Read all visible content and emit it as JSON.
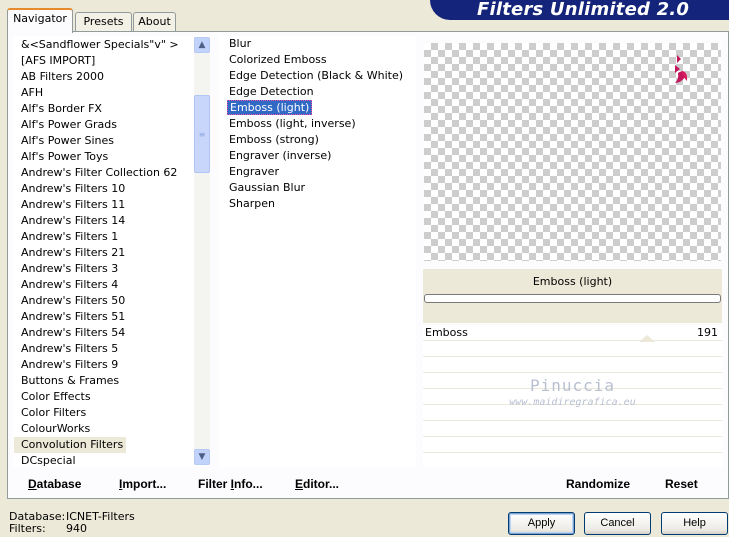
{
  "tabs": [
    {
      "label": "Navigator",
      "active": true
    },
    {
      "label": "Presets",
      "active": false
    },
    {
      "label": "About",
      "active": false
    }
  ],
  "app_title": "Filters Unlimited 2.0",
  "categories": [
    "&<Sandflower Specials\"v\" >",
    "[AFS IMPORT]",
    "AB Filters 2000",
    "AFH",
    "Alf's Border FX",
    "Alf's Power Grads",
    "Alf's Power Sines",
    "Alf's Power Toys",
    "Andrew's Filter Collection 62",
    "Andrew's Filters 10",
    "Andrew's Filters 11",
    "Andrew's Filters 14",
    "Andrew's Filters 1",
    "Andrew's Filters 21",
    "Andrew's Filters 3",
    "Andrew's Filters 4",
    "Andrew's Filters 50",
    "Andrew's Filters 51",
    "Andrew's Filters 54",
    "Andrew's Filters 5",
    "Andrew's Filters 9",
    "Buttons & Frames",
    "Color Effects",
    "Color Filters",
    "ColourWorks",
    "Convolution Filters",
    "DCspecial"
  ],
  "selected_category": "Convolution Filters",
  "filters": [
    "Blur",
    "Colorized Emboss",
    "Edge Detection (Black & White)",
    "Edge Detection",
    "Emboss (light)",
    "Emboss (light, inverse)",
    "Emboss (strong)",
    "Engraver (inverse)",
    "Engraver",
    "Gaussian Blur",
    "Sharpen"
  ],
  "selected_filter": "Emboss (light)",
  "current_filter_name": "Emboss (light)",
  "params": [
    {
      "label": "Emboss",
      "value": "191"
    }
  ],
  "watermark": {
    "name": "Pinuccia",
    "url": "www.maidiregrafica.eu"
  },
  "bottom": {
    "database": {
      "underlined": "D",
      "rest": "atabase"
    },
    "import": {
      "underlined": "I",
      "rest": "mport..."
    },
    "filter_info": {
      "pre": "Filter ",
      "underlined": "I",
      "rest": "nfo..."
    },
    "editor": {
      "underlined": "E",
      "rest": "ditor..."
    },
    "randomize": "Randomize",
    "reset": "Reset"
  },
  "status": {
    "database_label": "Database:",
    "database_value": "ICNET-Filters",
    "filters_label": "Filters:",
    "filters_value": "940"
  },
  "dialog": {
    "apply": "Apply",
    "cancel": "Cancel",
    "help": "Help"
  },
  "colors": {
    "banner": "#14247a",
    "selection": "#316ac5",
    "mark": "#c2185b"
  }
}
